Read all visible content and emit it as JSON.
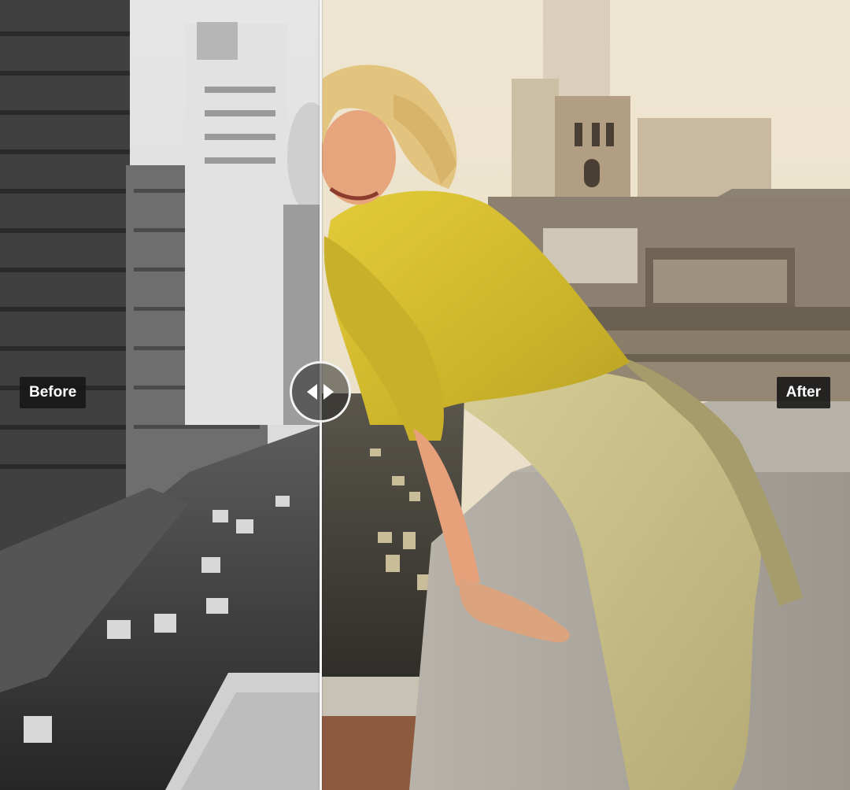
{
  "labels": {
    "before": "Before",
    "after": "After"
  },
  "slider": {
    "position_fraction": 0.377
  },
  "icons": {
    "handle_left": "chevron-left-icon",
    "handle_right": "chevron-right-icon"
  },
  "colors": {
    "sky_before": "#e8e8e8",
    "sky_after": "#ede4d0",
    "dress_yellow": "#d8c232",
    "skirt": "#cbc08a",
    "skin": "#e6a07a",
    "hair": "#e2c27c",
    "ledge": "#a8a39a",
    "label_bg": "#161616"
  }
}
